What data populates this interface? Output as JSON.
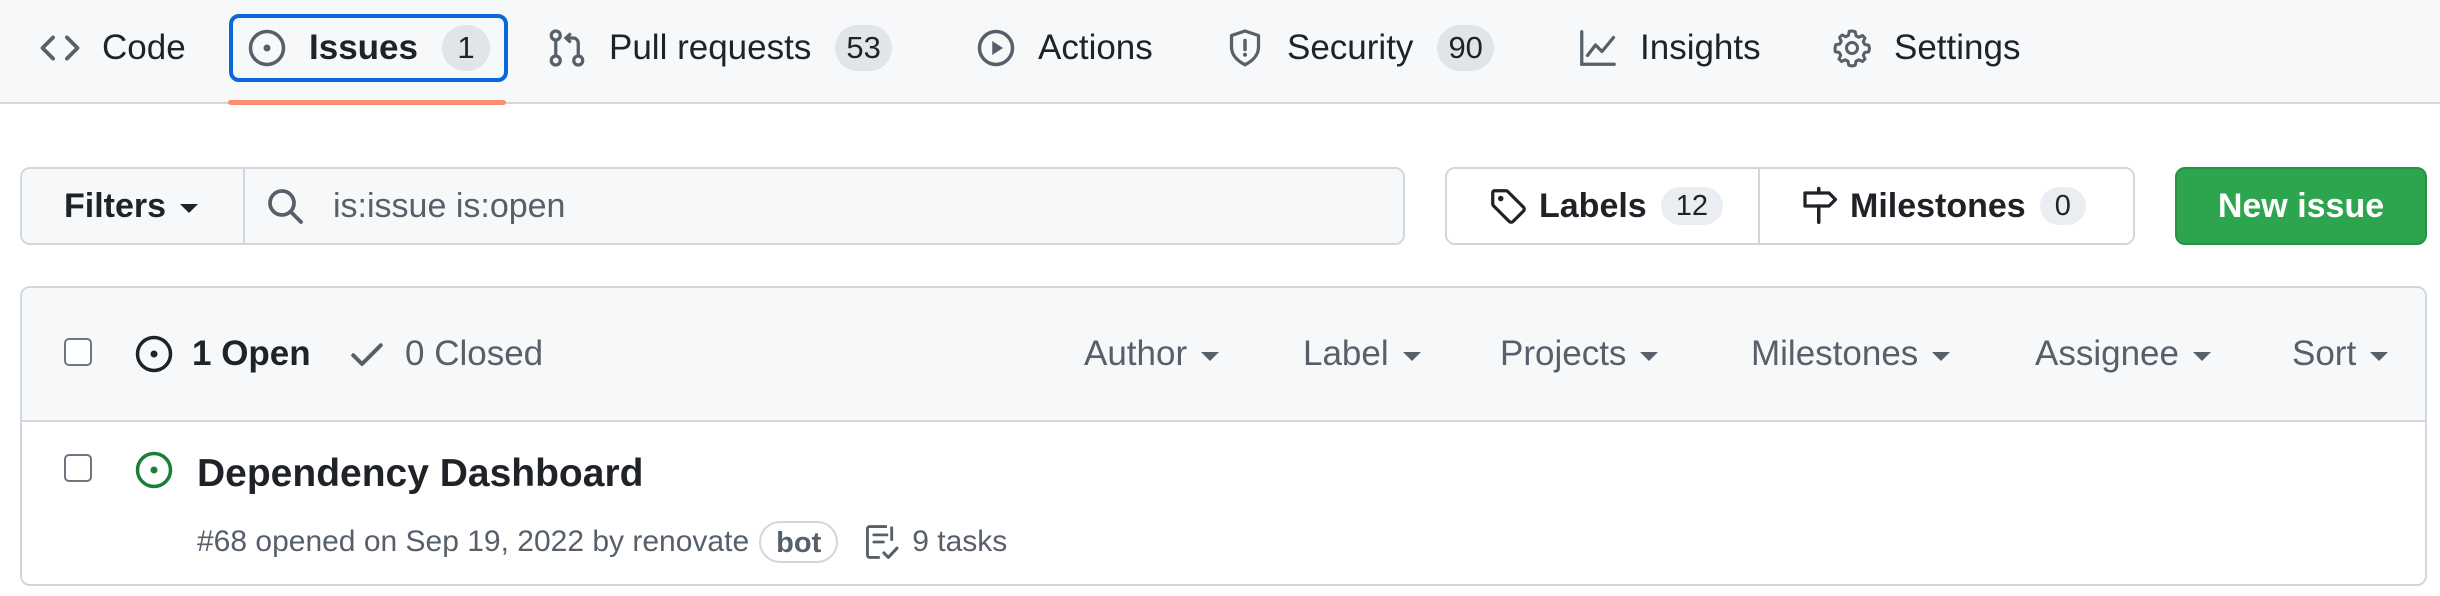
{
  "nav": {
    "tabs": [
      {
        "label": "Code",
        "icon": "code-icon"
      },
      {
        "label": "Issues",
        "icon": "issue-opened-icon",
        "counter": "1",
        "selected": true
      },
      {
        "label": "Pull requests",
        "icon": "git-pull-request-icon",
        "counter": "53"
      },
      {
        "label": "Actions",
        "icon": "play-icon"
      },
      {
        "label": "Security",
        "icon": "shield-icon",
        "counter": "90"
      },
      {
        "label": "Insights",
        "icon": "graph-icon"
      },
      {
        "label": "Settings",
        "icon": "gear-icon"
      }
    ],
    "selected_underline_color": "#fd8c73"
  },
  "filters": {
    "button_label": "Filters",
    "search_value": "is:issue is:open"
  },
  "labels_button": {
    "label": "Labels",
    "count": "12"
  },
  "milestones_button": {
    "label": "Milestones",
    "count": "0"
  },
  "new_issue_label": "New issue",
  "list_header": {
    "open_label": "1 Open",
    "closed_label": "0 Closed",
    "filters": [
      "Author",
      "Label",
      "Projects",
      "Milestones",
      "Assignee",
      "Sort"
    ]
  },
  "issues": [
    {
      "title": "Dependency Dashboard",
      "meta": "#68 opened on Sep 19, 2022 by renovate",
      "badge": "bot",
      "tasks": "9 tasks",
      "state": "open"
    }
  ],
  "colors": {
    "accent": "#0969da",
    "open_green": "#1a7f37",
    "primary_button": "#2da44e"
  }
}
